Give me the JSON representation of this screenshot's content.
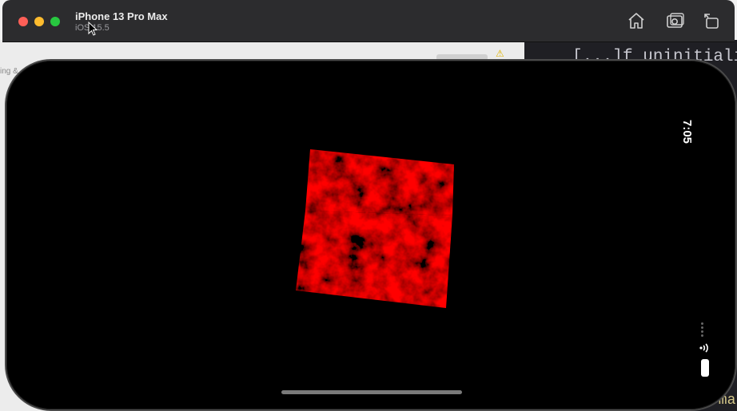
{
  "window": {
    "device_name": "iPhone 13 Pro Max",
    "os_version": "iOS 15.5"
  },
  "toolbar": {
    "home_icon": "home-icon",
    "screenshot_icon": "screenshot-icon",
    "rotate_icon": "rotate-icon"
  },
  "background": {
    "code_line": "[...]f uninitialis",
    "code_bottom": "vma",
    "side_text": "ing &"
  },
  "status_bar": {
    "time": "7:05"
  },
  "colors": {
    "cube_red": "#ff0000",
    "toolbar_bg": "#2c2c2e"
  }
}
